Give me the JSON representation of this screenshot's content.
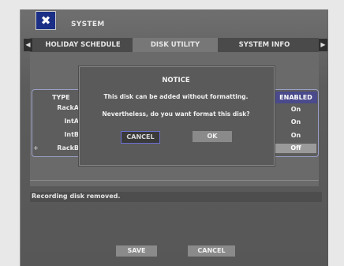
{
  "header": {
    "title": "SYSTEM",
    "icon": "tools-icon"
  },
  "tabs": [
    {
      "label": "HOLIDAY SCHEDULE"
    },
    {
      "label": "DISK UTILITY",
      "active": true
    },
    {
      "label": "SYSTEM INFO"
    }
  ],
  "table": {
    "type_header": "TYPE",
    "enabled_header": "ENABLED",
    "rows": [
      {
        "type": "RackA",
        "enabled": "On"
      },
      {
        "type": "IntA",
        "enabled": "On"
      },
      {
        "type": "IntB",
        "enabled": "On"
      },
      {
        "type": "RackB",
        "enabled": "Off",
        "marker": "+"
      }
    ]
  },
  "dialog": {
    "title": "NOTICE",
    "line1": "This disk can be added without formatting.",
    "line2": "Nevertheless, do you want format this disk?",
    "cancel_label": "CANCEL",
    "ok_label": "OK"
  },
  "status": {
    "message": "Recording disk removed."
  },
  "footer": {
    "save_label": "SAVE",
    "cancel_label": "CANCEL"
  },
  "colors": {
    "accent": "#1b2f86",
    "selection_border": "#6a6fd0",
    "header_blue": "#4a4a8c"
  }
}
